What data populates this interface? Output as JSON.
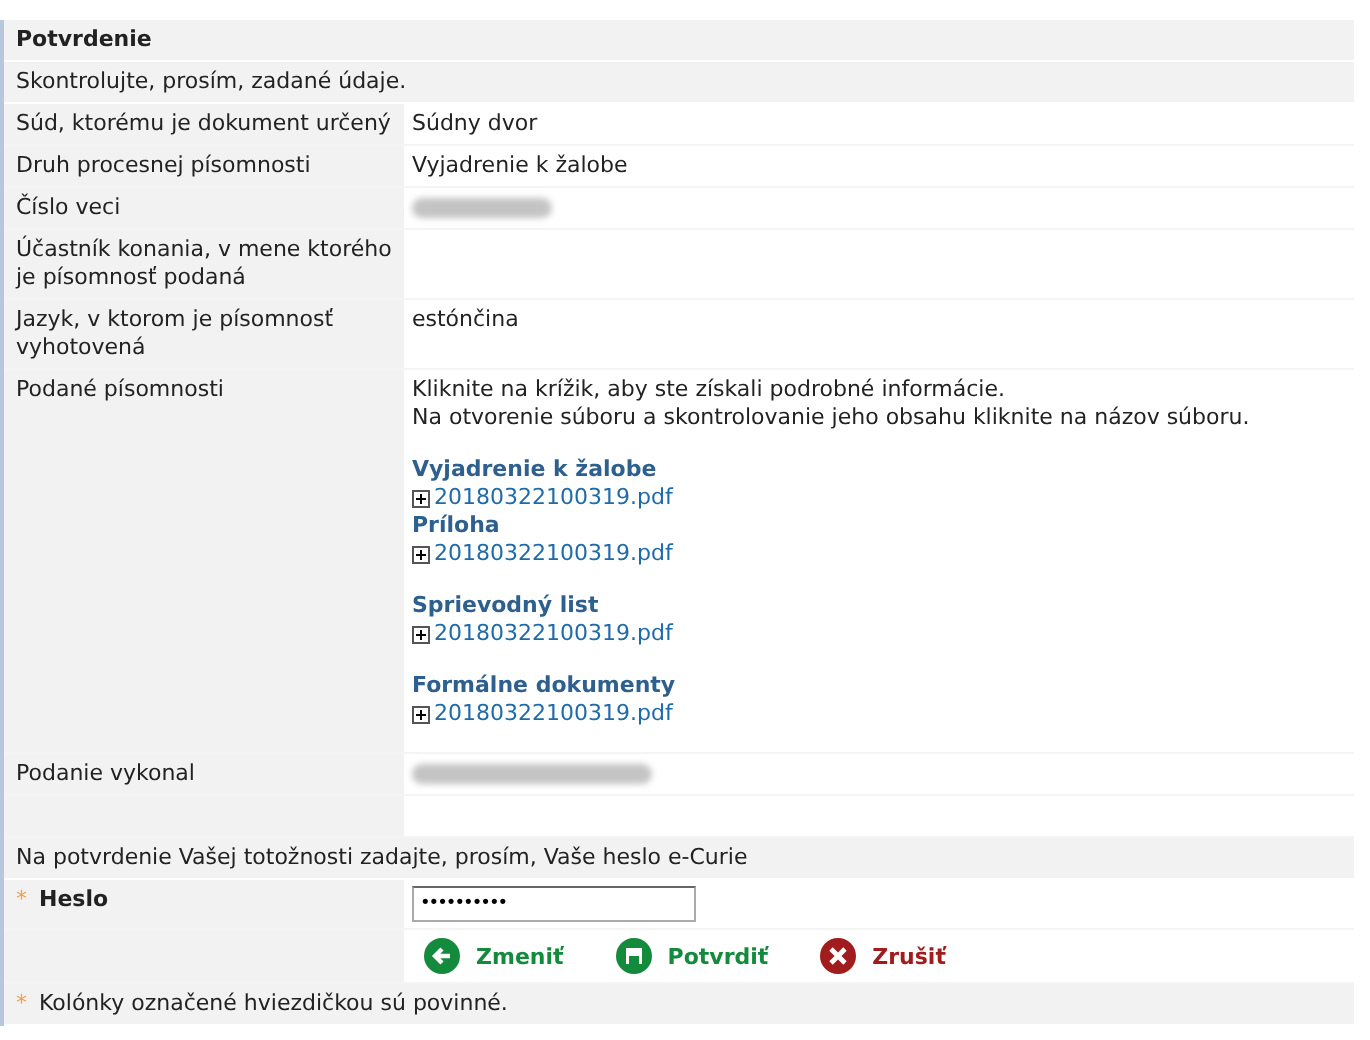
{
  "title": "Potvrdenie",
  "instruction": "Skontrolujte, prosím, zadané údaje.",
  "fields": [
    {
      "label": "Súd, ktorému je dokument určený",
      "value": "Súdny dvor"
    },
    {
      "label": "Druh procesnej písomnosti",
      "value": "Vyjadrenie k žalobe"
    },
    {
      "label": "Číslo veci",
      "redacted": true
    },
    {
      "label": "Účastník konania, v mene ktorého je písomnosť podaná"
    },
    {
      "label": "Jazyk, v ktorom je písomnosť vyhotovená",
      "value": "estónčina"
    }
  ],
  "documents": {
    "label": "Podané písomnosti",
    "hint_lines": [
      "Kliknite na krížik, aby ste získali podrobné informácie.",
      "Na otvorenie súboru a skontrolovanie jeho obsahu kliknite na názov súboru."
    ],
    "groups": [
      {
        "title": "Vyjadrenie k žalobe",
        "files": [
          "20180322100319.pdf"
        ]
      },
      {
        "title": "Príloha",
        "files": [
          "20180322100319.pdf"
        ]
      },
      {
        "title": "Sprievodný list",
        "files": [
          "20180322100319.pdf"
        ]
      },
      {
        "title": "Formálne dokumenty",
        "files": [
          "20180322100319.pdf"
        ]
      }
    ]
  },
  "submitter": {
    "label": "Podanie vykonal",
    "redacted": true
  },
  "password_prompt": "Na potvrdenie Vašej totožnosti zadajte, prosím, Vaše heslo e-Curie",
  "password": {
    "required_mark": "*",
    "label": "Heslo",
    "value": "••••••••••"
  },
  "buttons": [
    {
      "kind": "back",
      "label": "Zmeniť"
    },
    {
      "kind": "save",
      "label": "Potvrdiť"
    },
    {
      "kind": "cancel",
      "label": "Zrušiť"
    }
  ],
  "footnote": {
    "mark": "*",
    "text": "Kolónky označené hviezdičkou sú povinné."
  }
}
